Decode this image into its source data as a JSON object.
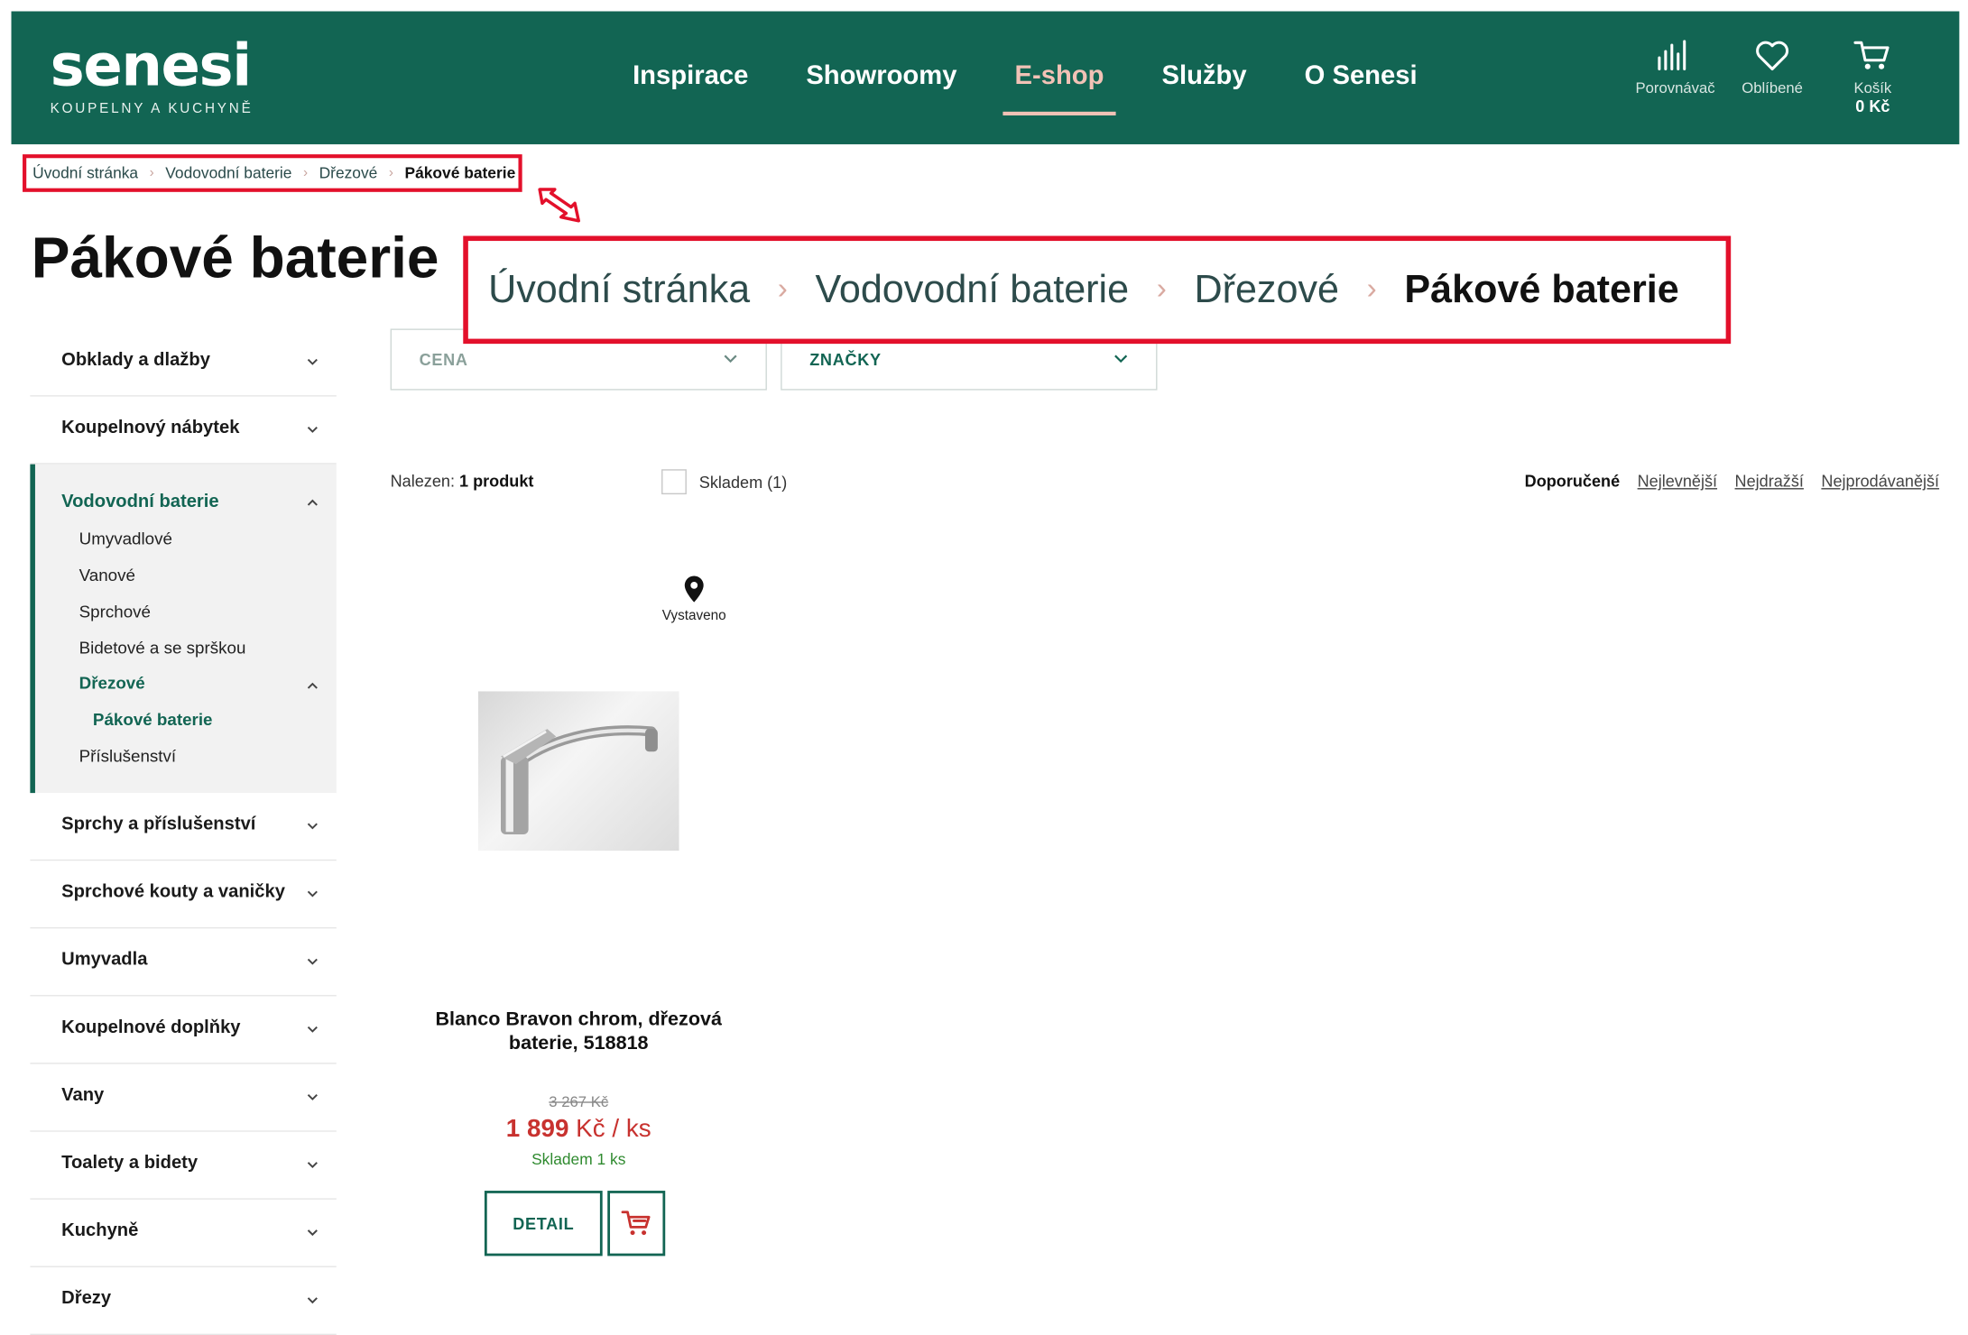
{
  "brand": {
    "name": "senesi",
    "tagline": "KOUPELNY A KUCHYNĚ"
  },
  "nav": [
    {
      "label": "Inspirace",
      "active": false
    },
    {
      "label": "Showroomy",
      "active": false
    },
    {
      "label": "E-shop",
      "active": true
    },
    {
      "label": "Služby",
      "active": false
    },
    {
      "label": "O Senesi",
      "active": false
    }
  ],
  "header_icons": {
    "compare": {
      "label": "Porovnávač",
      "icon": "compare-bars-icon"
    },
    "favorites": {
      "label": "Oblíbené",
      "icon": "heart-icon"
    },
    "cart": {
      "label": "Košík",
      "total": "0 Kč",
      "icon": "cart-icon"
    }
  },
  "breadcrumb": [
    "Úvodní stránka",
    "Vodovodní baterie",
    "Dřezové",
    "Pákové baterie"
  ],
  "page_title": "Pákové baterie",
  "sidebar": {
    "categories_before": [
      "Obklady a dlažby",
      "Koupelnový nábytek"
    ],
    "open_category": {
      "label": "Vodovodní baterie",
      "children": [
        "Umyvadlové",
        "Vanové",
        "Sprchové",
        "Bidetové a se sprškou",
        "Dřezové",
        "Příslušenství"
      ],
      "active_child": "Dřezové",
      "active_grandchild": "Pákové baterie"
    },
    "categories_after": [
      "Sprchy a příslušenství",
      "Sprchové kouty a vaničky",
      "Umyvadla",
      "Koupelnové doplňky",
      "Vany",
      "Toalety a bidety",
      "Kuchyně",
      "Dřezy"
    ]
  },
  "filters": {
    "price": "CENA",
    "brands": "ZNAČKY"
  },
  "results": {
    "found_prefix": "Nalezen:",
    "found_count": "1 produkt",
    "stock_label": "Skladem (1)",
    "stock_checked": false
  },
  "sort": {
    "options": [
      "Doporučené",
      "Nejlevnější",
      "Nejdražší",
      "Nejprodávanější"
    ],
    "selected": "Doporučené"
  },
  "product": {
    "badge": "Vystaveno",
    "name": "Blanco Bravon chrom, dřezová baterie, 518818",
    "old_price": "3 267 Kč",
    "price_value": "1 899",
    "price_unit": "Kč / ks",
    "availability": "Skladem 1 ks",
    "detail_label": "DETAIL"
  },
  "colors": {
    "brand_green": "#126553",
    "accent_pink": "#f2c2b6",
    "price_red": "#c8322f",
    "stock_green": "#2f8a2f",
    "highlight_red": "#e3102b"
  }
}
